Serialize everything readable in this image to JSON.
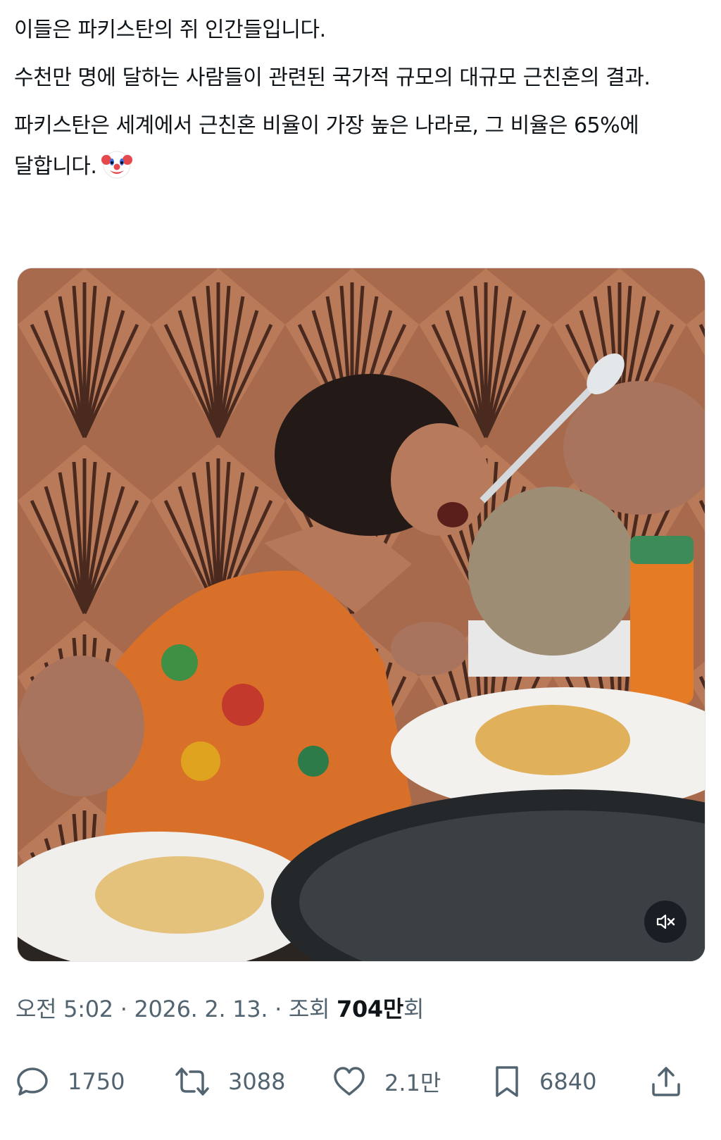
{
  "post": {
    "paragraphs": [
      "이들은 파키스탄의 쥐 인간들입니다.",
      "수천만 명에 달하는 사람들이 관련된 국가적 규모의 대규모 근친혼의 결과.",
      "파키스탄은 세계에서 근친혼 비율이 가장 높은 나라로, 그 비율은 65%에 달합니다."
    ],
    "emoji": "clown-face-emoji"
  },
  "media": {
    "mute_icon": "speaker-muted-icon"
  },
  "meta": {
    "time": "오전 5:02",
    "separator": "·",
    "date": "2026. 2. 13.",
    "views_label": "조회",
    "views_count": "704만",
    "views_unit": "회"
  },
  "actions": {
    "replies": "1750",
    "reposts": "3088",
    "likes": "2.1만",
    "bookmarks": "6840"
  },
  "colors": {
    "text": "#0f1419",
    "secondary": "#536471"
  }
}
